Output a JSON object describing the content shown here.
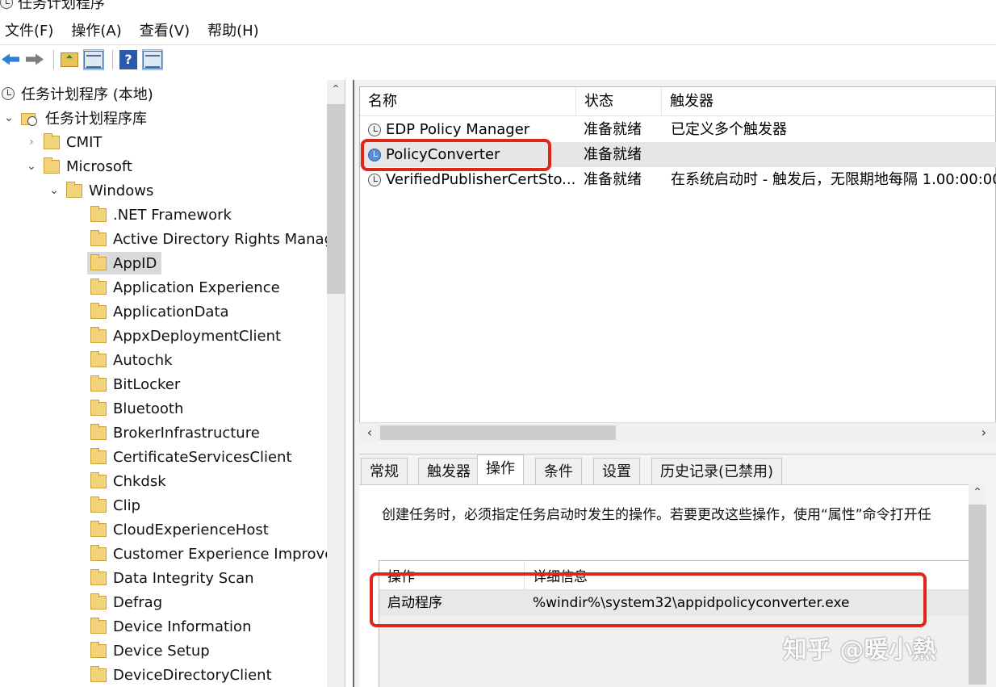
{
  "window": {
    "title": "任务计划程序"
  },
  "menu": {
    "items": [
      "文件(F)",
      "操作(A)",
      "查看(V)",
      "帮助(H)"
    ]
  },
  "toolbar": {
    "buttons": [
      "back-arrow-icon",
      "forward-arrow-icon",
      "up-folder-icon",
      "show-hide-pane-icon",
      "help-icon",
      "action-pane-icon"
    ]
  },
  "tree": {
    "root": "任务计划程序 (本地)",
    "library": "任务计划程序库",
    "cmit": "CMIT",
    "microsoft": "Microsoft",
    "windows": "Windows",
    "windows_children": [
      ".NET Framework",
      "Active Directory Rights Manag",
      "AppID",
      "Application Experience",
      "ApplicationData",
      "AppxDeploymentClient",
      "Autochk",
      "BitLocker",
      "Bluetooth",
      "BrokerInfrastructure",
      "CertificateServicesClient",
      "Chkdsk",
      "Clip",
      "CloudExperienceHost",
      "Customer Experience Improve",
      "Data Integrity Scan",
      "Defrag",
      "Device Information",
      "Device Setup",
      "DeviceDirectoryClient"
    ],
    "selected": "AppID"
  },
  "task_list": {
    "columns": [
      "名称",
      "状态",
      "触发器"
    ],
    "rows": [
      {
        "name": "EDP Policy Manager",
        "status": "准备就绪",
        "trigger": "已定义多个触发器"
      },
      {
        "name": "PolicyConverter",
        "status": "准备就绪",
        "trigger": ""
      },
      {
        "name": "VerifiedPublisherCertSto...",
        "status": "准备就绪",
        "trigger": "在系统启动时 - 触发后，无限期地每隔 1.00:00:00"
      }
    ],
    "selected_index": 1
  },
  "tabs": {
    "items": [
      "常规",
      "触发器",
      "操作",
      "条件",
      "设置",
      "历史记录(已禁用)"
    ],
    "active": "操作"
  },
  "details": {
    "description": "创建任务时，必须指定任务启动时发生的操作。若要更改这些操作，使用“属性”命令打开任",
    "columns": [
      "操作",
      "详细信息"
    ],
    "rows": [
      {
        "action": "启动程序",
        "detail": "%windir%\\system32\\appidpolicyconverter.exe"
      }
    ]
  },
  "watermark": "知乎 @暖小熱",
  "colors": {
    "highlight_red": "#e0251b",
    "selection_gray": "#e6e6e6"
  }
}
